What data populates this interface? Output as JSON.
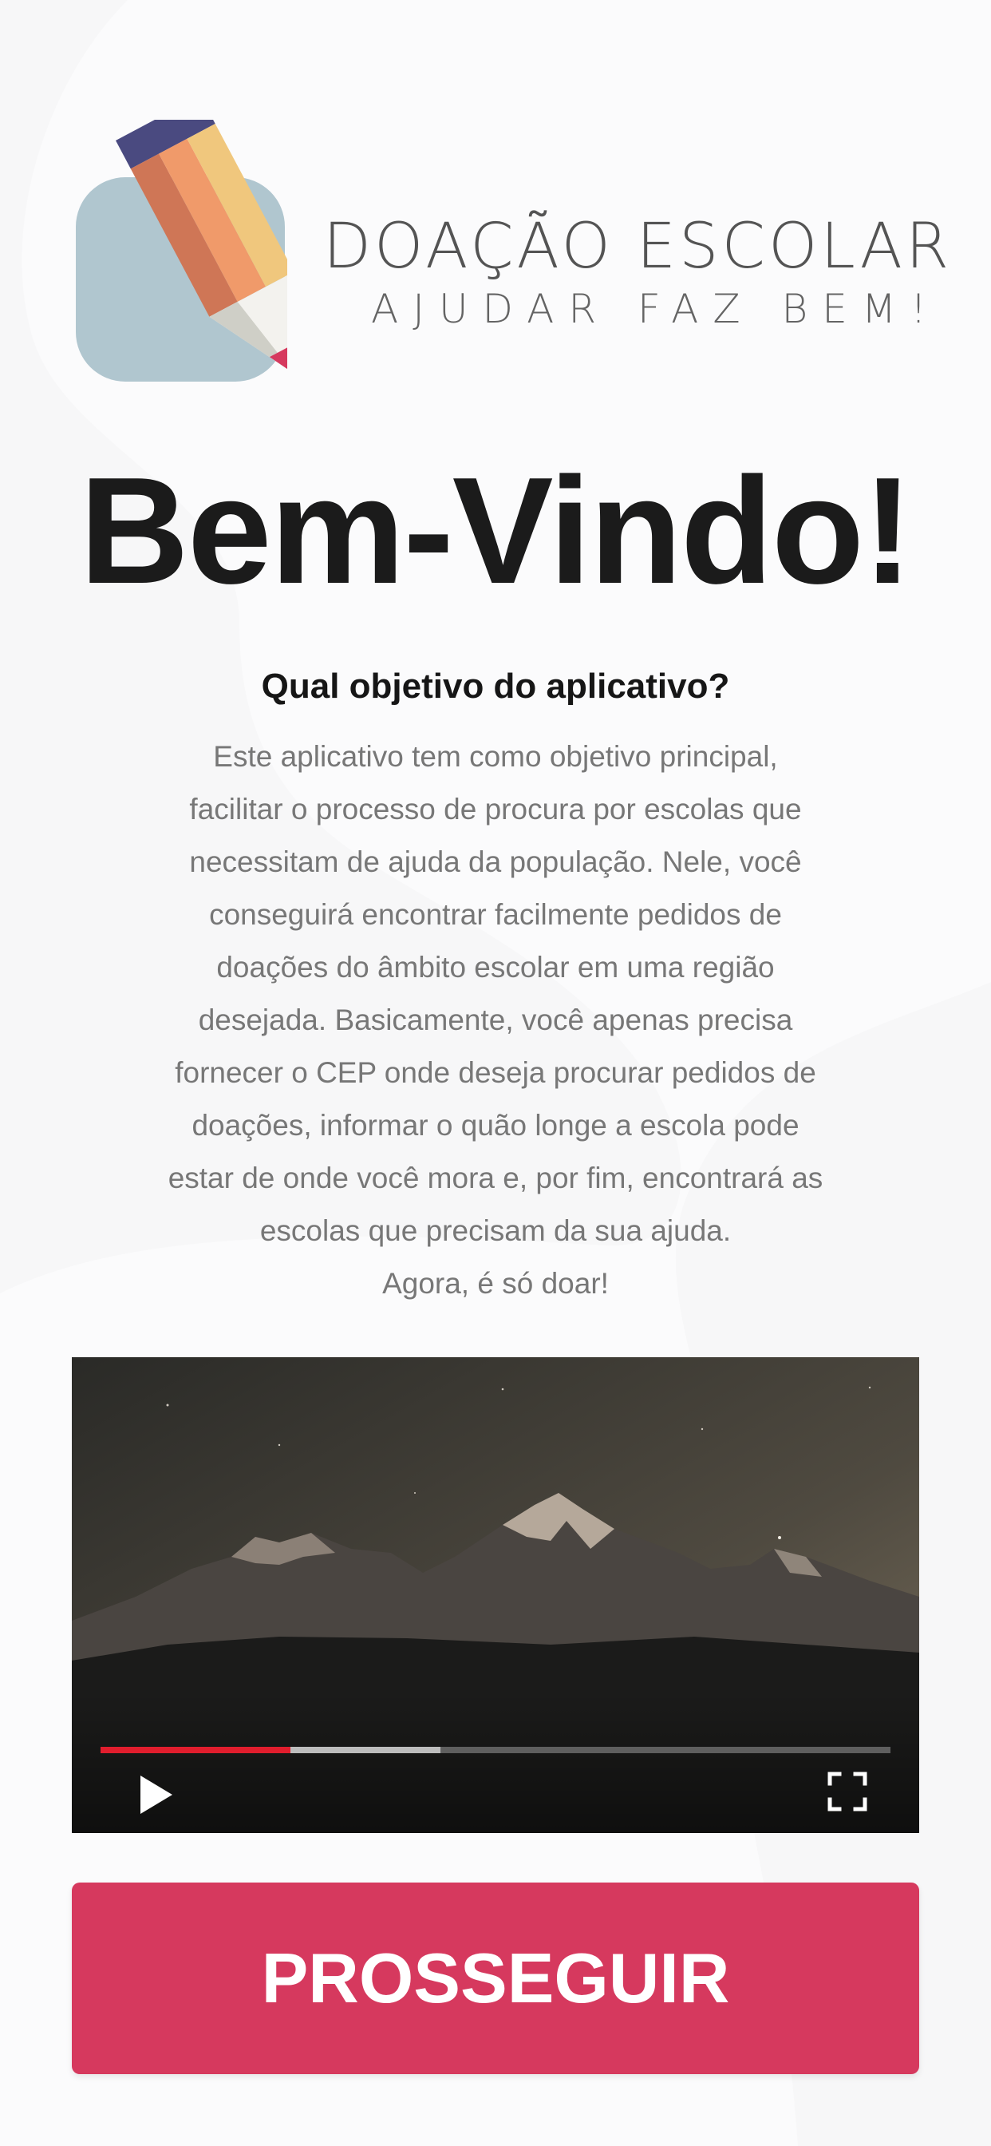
{
  "brand": {
    "title": "DOAÇÃO ESCOLAR",
    "subtitle": "AJUDAR FAZ BEM!",
    "logo_icon": "pencil-icon"
  },
  "welcome": {
    "heading": "Bem-Vindo!"
  },
  "objective": {
    "title": "Qual objetivo do aplicativo?",
    "lines": [
      "Este aplicativo tem como objetivo principal,",
      "facilitar o processo de procura por escolas que",
      "necessitam de ajuda da população. Nele, você",
      "conseguirá encontrar facilmente pedidos de",
      "doações do âmbito escolar em uma região",
      "desejada. Basicamente, você apenas precisa",
      "fornecer o CEP onde deseja procurar pedidos de",
      "doações, informar o quão longe a escola pode",
      "estar de onde você mora e, por fim, encontrará as",
      "escolas que precisam da sua ajuda.",
      "Agora, é só doar!"
    ]
  },
  "video": {
    "played_fraction": 0.24,
    "buffered_fraction": 0.43,
    "colors": {
      "played": "#e11d2d",
      "buffered": "#bdbdbd"
    },
    "icons": [
      "play-icon",
      "fullscreen-icon"
    ]
  },
  "actions": {
    "proceed_label": "PROSSEGUIR",
    "proceed_color": "#d6395e"
  }
}
